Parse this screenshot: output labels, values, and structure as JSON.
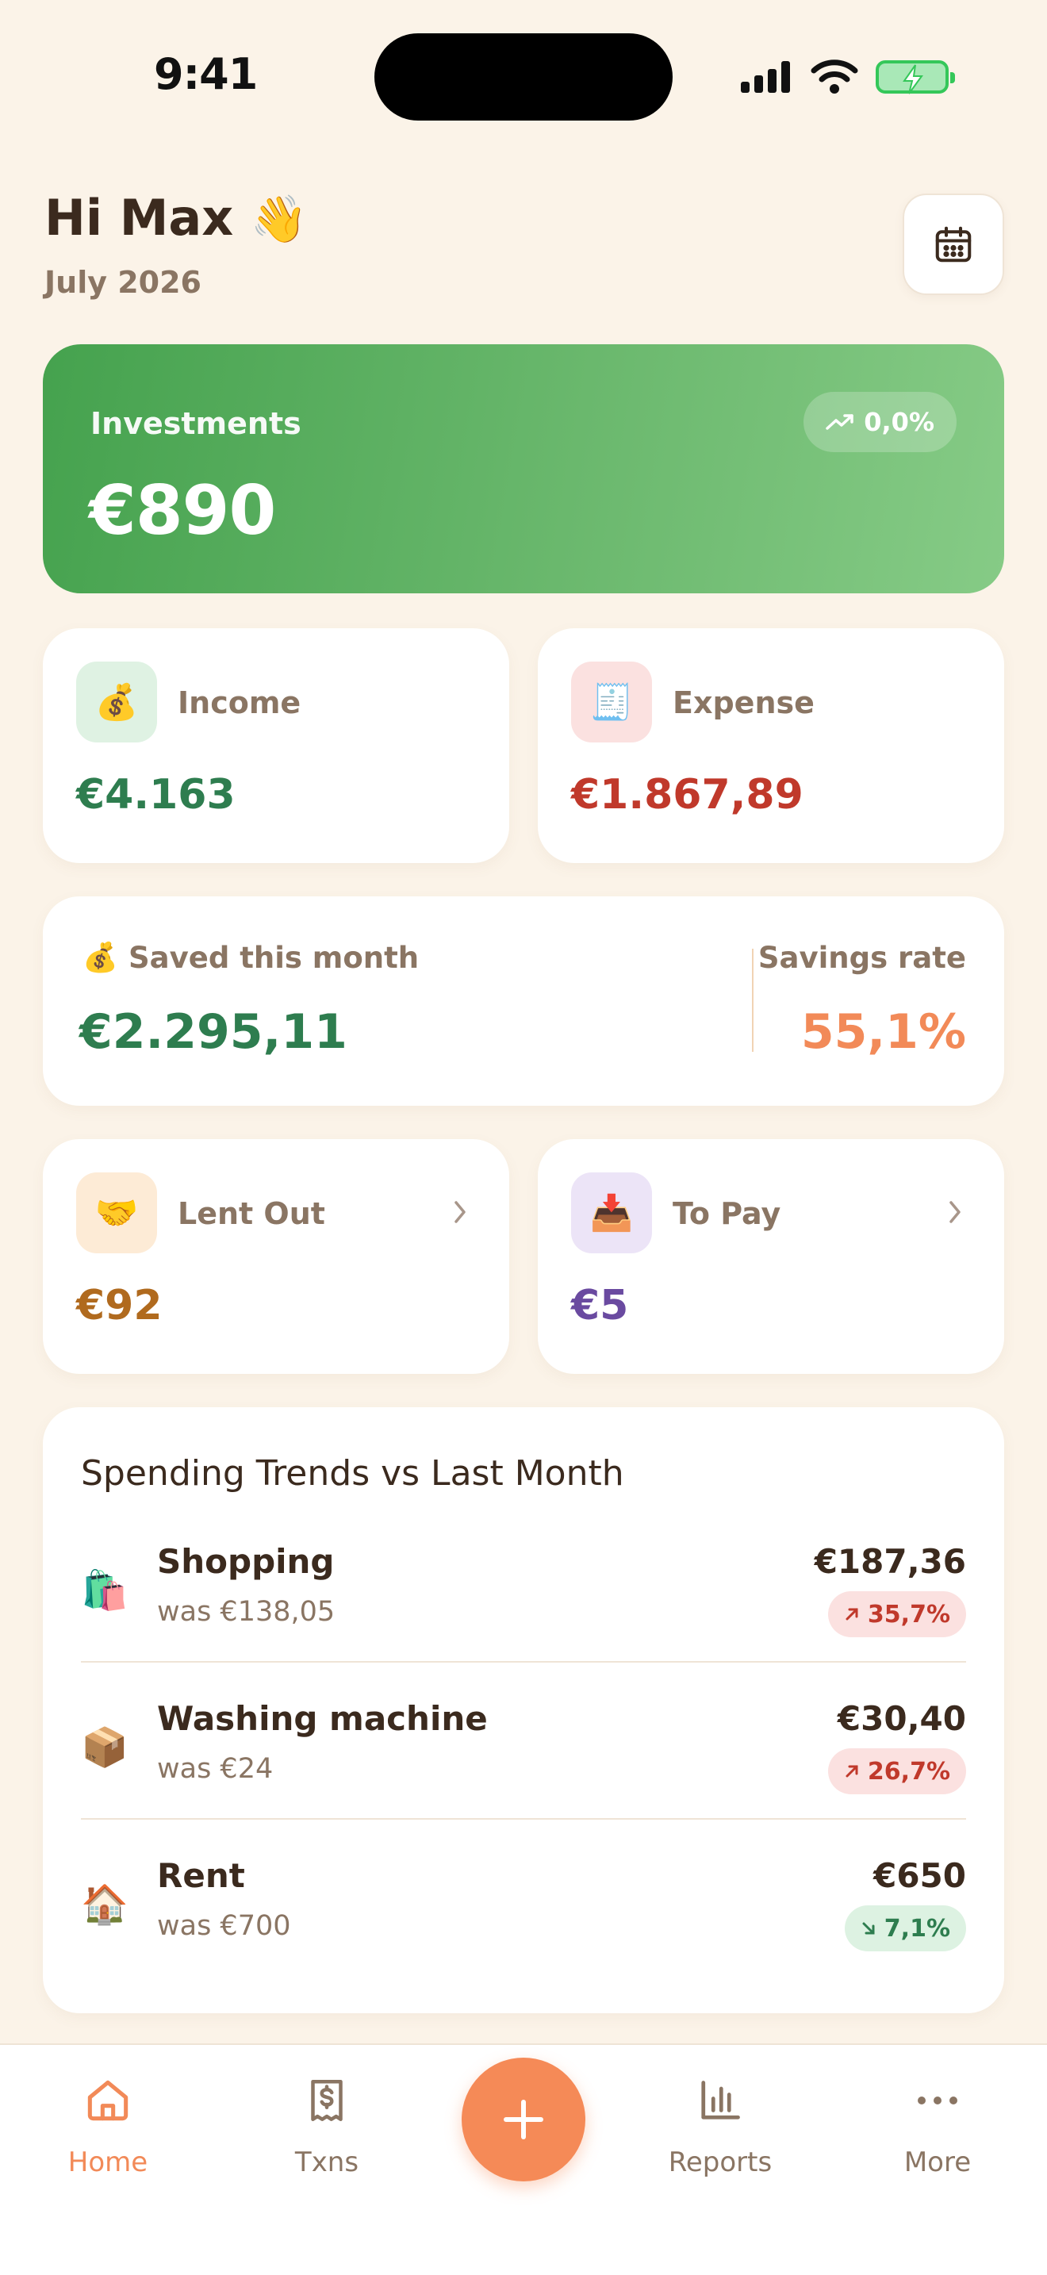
{
  "status_bar": {
    "time": "9:41"
  },
  "header": {
    "greeting": "Hi Max",
    "greeting_emoji": "👋",
    "date": "July 2026",
    "calendar_icon": "calendar-icon"
  },
  "investments": {
    "label": "Investments",
    "value": "€890",
    "change": "0,0%",
    "change_icon": "trend-up-icon"
  },
  "income": {
    "label": "Income",
    "value": "€4.163",
    "emoji": "💰",
    "color": "#2E7D4F"
  },
  "expense": {
    "label": "Expense",
    "value": "€1.867,89",
    "emoji": "🧾",
    "color": "#C0392B"
  },
  "saved": {
    "emoji": "💰",
    "label": "Saved this month",
    "value": "€2.295,11",
    "rate_label": "Savings rate",
    "rate_value": "55,1%"
  },
  "lent_out": {
    "label": "Lent Out",
    "value": "€92",
    "emoji": "🤝",
    "color": "#B06A1E"
  },
  "to_pay": {
    "label": "To Pay",
    "value": "€5",
    "emoji": "📥",
    "color": "#6A4AA0"
  },
  "trends": {
    "title": "Spending Trends vs Last Month",
    "items": [
      {
        "emoji": "🛍️",
        "name": "Shopping",
        "was": "was €138,05",
        "amount": "€187,36",
        "change": "35,7%",
        "direction": "up"
      },
      {
        "emoji": "📦",
        "name": "Washing machine",
        "was": "was €24",
        "amount": "€30,40",
        "change": "26,7%",
        "direction": "up"
      },
      {
        "emoji": "🏠",
        "name": "Rent",
        "was": "was €700",
        "amount": "€650",
        "change": "7,1%",
        "direction": "down"
      }
    ]
  },
  "nav": {
    "home": "Home",
    "txns": "Txns",
    "reports": "Reports",
    "more": "More",
    "add_icon": "plus-icon"
  },
  "colors": {
    "background": "#FBF3E8",
    "accent": "#F58A57",
    "green": "#2E7D4F",
    "red": "#C0392B"
  }
}
